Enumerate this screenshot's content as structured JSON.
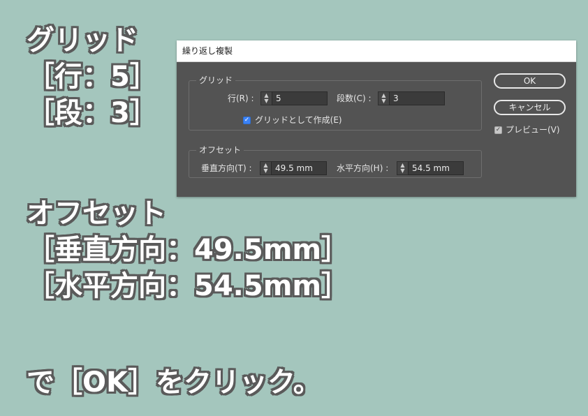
{
  "captions": {
    "grid_lines": [
      "グリッド",
      "［行：5］",
      "［段：3］"
    ],
    "offset_lines": [
      "オフセット",
      "［垂直方向：49.5mm］",
      "［水平方向：54.5mm］"
    ],
    "final_line": "で［OK］をクリック。"
  },
  "dialog": {
    "title": "繰り返し複製",
    "grid_group": {
      "legend": "グリッド",
      "rows_label": "行(R) :",
      "rows_value": "5",
      "cols_label": "段数(C) :",
      "cols_value": "3",
      "create_grid_label": "グリッドとして作成(E)",
      "create_grid_checked": true
    },
    "offset_group": {
      "legend": "オフセット",
      "vertical_label": "垂直方向(T) :",
      "vertical_value": "49.5 mm",
      "horizontal_label": "水平方向(H) :",
      "horizontal_value": "54.5 mm"
    },
    "ok_label": "OK",
    "cancel_label": "キャンセル",
    "preview_label": "プレビュー(V)",
    "preview_checked": true
  },
  "colors": {
    "background": "#a4c6bd",
    "dialog_bg": "#535353",
    "checkbox_accent": "#3b82f6"
  }
}
